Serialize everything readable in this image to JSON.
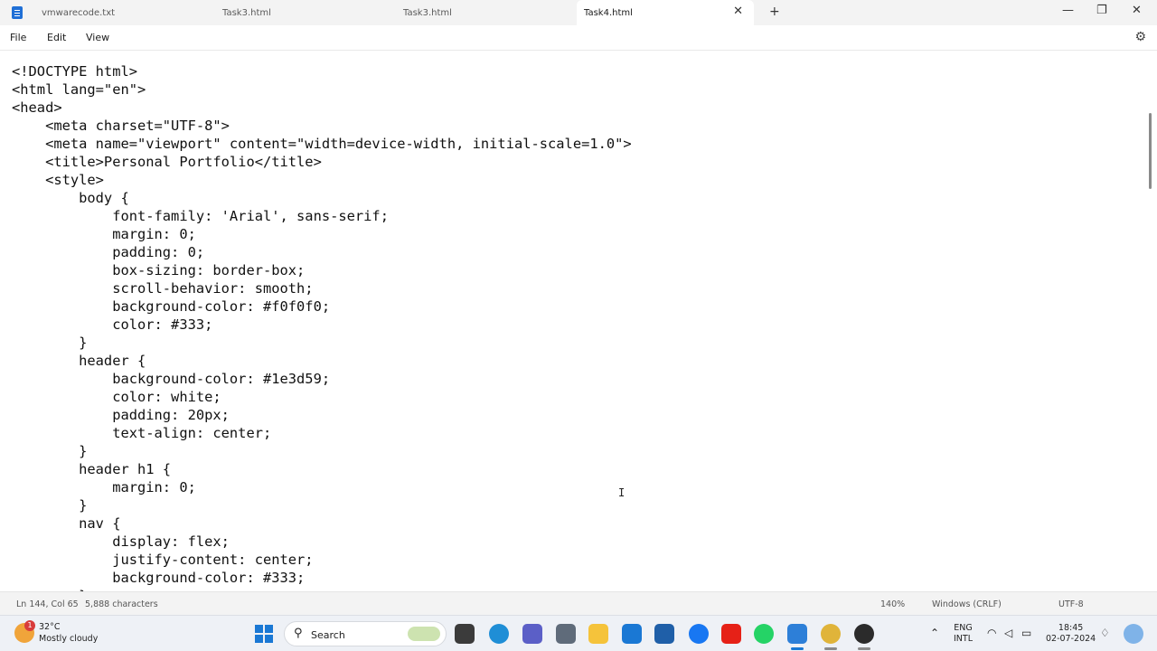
{
  "tabs": [
    {
      "label": "vmwarecode.txt",
      "active": false
    },
    {
      "label": "Task3.html",
      "active": false
    },
    {
      "label": "Task3.html",
      "active": false
    },
    {
      "label": "Task4.html",
      "active": true
    }
  ],
  "menu": {
    "file": "File",
    "edit": "Edit",
    "view": "View"
  },
  "editor": {
    "lines": [
      "<!DOCTYPE html>",
      "<html lang=\"en\">",
      "<head>",
      "    <meta charset=\"UTF-8\">",
      "    <meta name=\"viewport\" content=\"width=device-width, initial-scale=1.0\">",
      "    <title>Personal Portfolio</title>",
      "    <style>",
      "        body {",
      "            font-family: 'Arial', sans-serif;",
      "            margin: 0;",
      "            padding: 0;",
      "            box-sizing: border-box;",
      "            scroll-behavior: smooth;",
      "            background-color: #f0f0f0;",
      "            color: #333;",
      "        }",
      "        header {",
      "            background-color: #1e3d59;",
      "            color: white;",
      "            padding: 20px;",
      "            text-align: center;",
      "        }",
      "        header h1 {",
      "            margin: 0;",
      "        }",
      "        nav {",
      "            display: flex;",
      "            justify-content: center;",
      "            background-color: #333;",
      "        }"
    ]
  },
  "status": {
    "position": "Ln 144, Col 65",
    "characters": "5,888 characters",
    "zoom": "140%",
    "line_ending": "Windows (CRLF)",
    "encoding": "UTF-8"
  },
  "taskbar": {
    "weather_temp": "32°C",
    "weather_condition": "Mostly cloudy",
    "weather_badge": "1",
    "search_label": "Search",
    "language_1": "ENG",
    "language_2": "INTL",
    "time": "18:45",
    "date": "02-07-2024"
  },
  "colors": {
    "accent": "#1a78d4"
  }
}
